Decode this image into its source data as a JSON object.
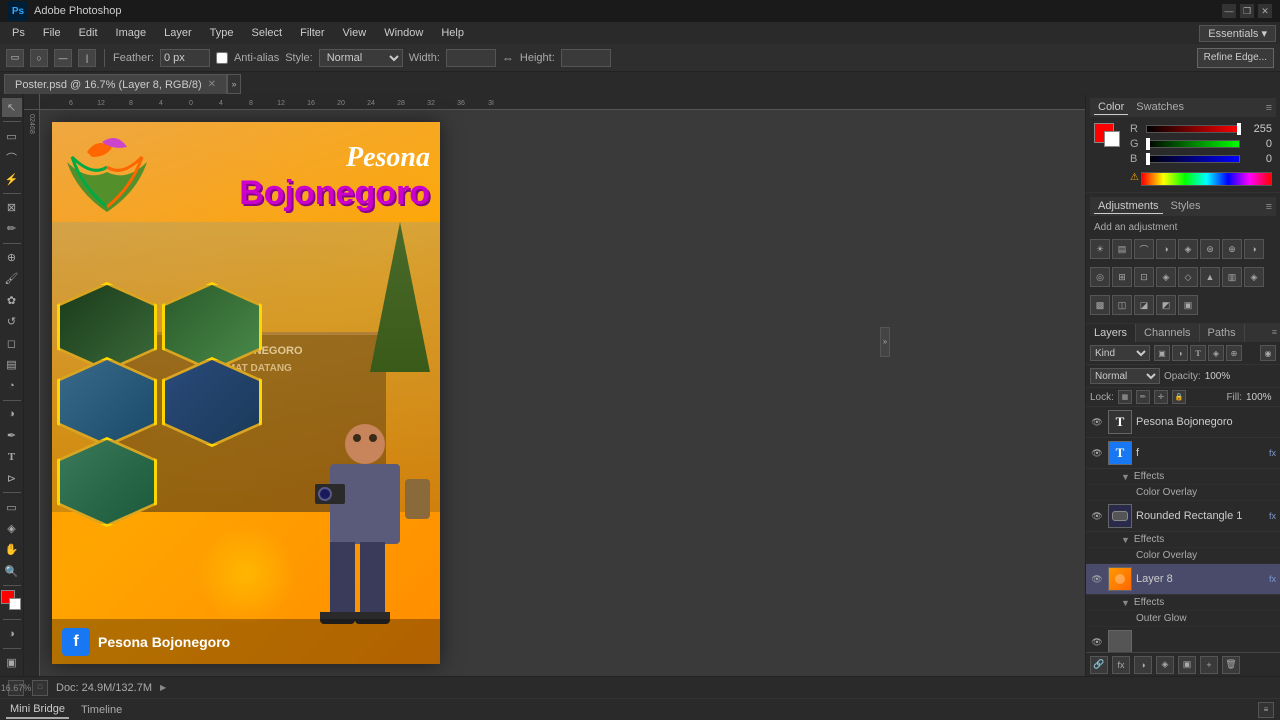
{
  "titlebar": {
    "logo": "Ps",
    "title": "Adobe Photoshop",
    "controls": [
      "—",
      "❐",
      "✕"
    ]
  },
  "menubar": {
    "items": [
      "PS",
      "File",
      "Edit",
      "Image",
      "Layer",
      "Type",
      "Select",
      "Filter",
      "View",
      "Window",
      "Help"
    ]
  },
  "optionsbar": {
    "feather_label": "Feather:",
    "feather_value": "0 px",
    "anti_alias_label": "Anti-alias",
    "style_label": "Style:",
    "style_value": "Normal",
    "width_label": "Width:",
    "height_label": "Height:",
    "refine_btn": "Refine Edge..."
  },
  "tabbar": {
    "active_tab": "Poster.psd @ 16.7% (Layer 8, RGB/8)",
    "close": "✕"
  },
  "canvas": {
    "doc_title": "Poster.psd @ 16.7% (Layer 8, RGB/8)"
  },
  "poster": {
    "pesona": "Pesona",
    "bojonegoro": "Bojonegoro",
    "gate_line1": "KOTA BOJONEGORO",
    "gate_line2": "SELAMAT DATANG",
    "fb_icon": "f",
    "footer_text": "Pesona Bojonegoro"
  },
  "color_panel": {
    "title": "Color",
    "tab2": "Swatches",
    "r_label": "R",
    "r_value": "255",
    "g_label": "G",
    "g_value": "0",
    "b_label": "B",
    "b_value": "0"
  },
  "adjustments_panel": {
    "title": "Adjustments",
    "tab2": "Styles",
    "add_text": "Add an adjustment"
  },
  "layers_panel": {
    "tabs": [
      "Layers",
      "Channels",
      "Paths"
    ],
    "kind_label": "Kind",
    "blend_mode": "Normal",
    "opacity_label": "Opacity:",
    "opacity_value": "100%",
    "fill_label": "Fill:",
    "fill_value": "100%",
    "lock_label": "Lock:",
    "layers": [
      {
        "id": 1,
        "type": "text",
        "name": "Pesona Bojonegoro",
        "visible": true,
        "fx": false,
        "active": false,
        "sub": []
      },
      {
        "id": 2,
        "type": "text",
        "name": "f",
        "visible": true,
        "fx": true,
        "active": false,
        "sub": [
          {
            "name": "Effects"
          },
          {
            "name": "Color Overlay"
          }
        ]
      },
      {
        "id": 3,
        "type": "shape",
        "name": "Rounded Rectangle 1",
        "visible": true,
        "fx": true,
        "active": false,
        "sub": [
          {
            "name": "Effects"
          },
          {
            "name": "Color Overlay"
          }
        ]
      },
      {
        "id": 4,
        "type": "image",
        "name": "Layer 8",
        "visible": true,
        "fx": true,
        "active": true,
        "sub": [
          {
            "name": "Effects"
          },
          {
            "name": "Outer Glow"
          }
        ]
      }
    ]
  },
  "statusbar": {
    "zoom": "16.67%",
    "doc_size": "Doc: 24.9M/132.7M"
  },
  "bottom_panel": {
    "tabs": [
      "Mini Bridge",
      "Timeline"
    ]
  }
}
